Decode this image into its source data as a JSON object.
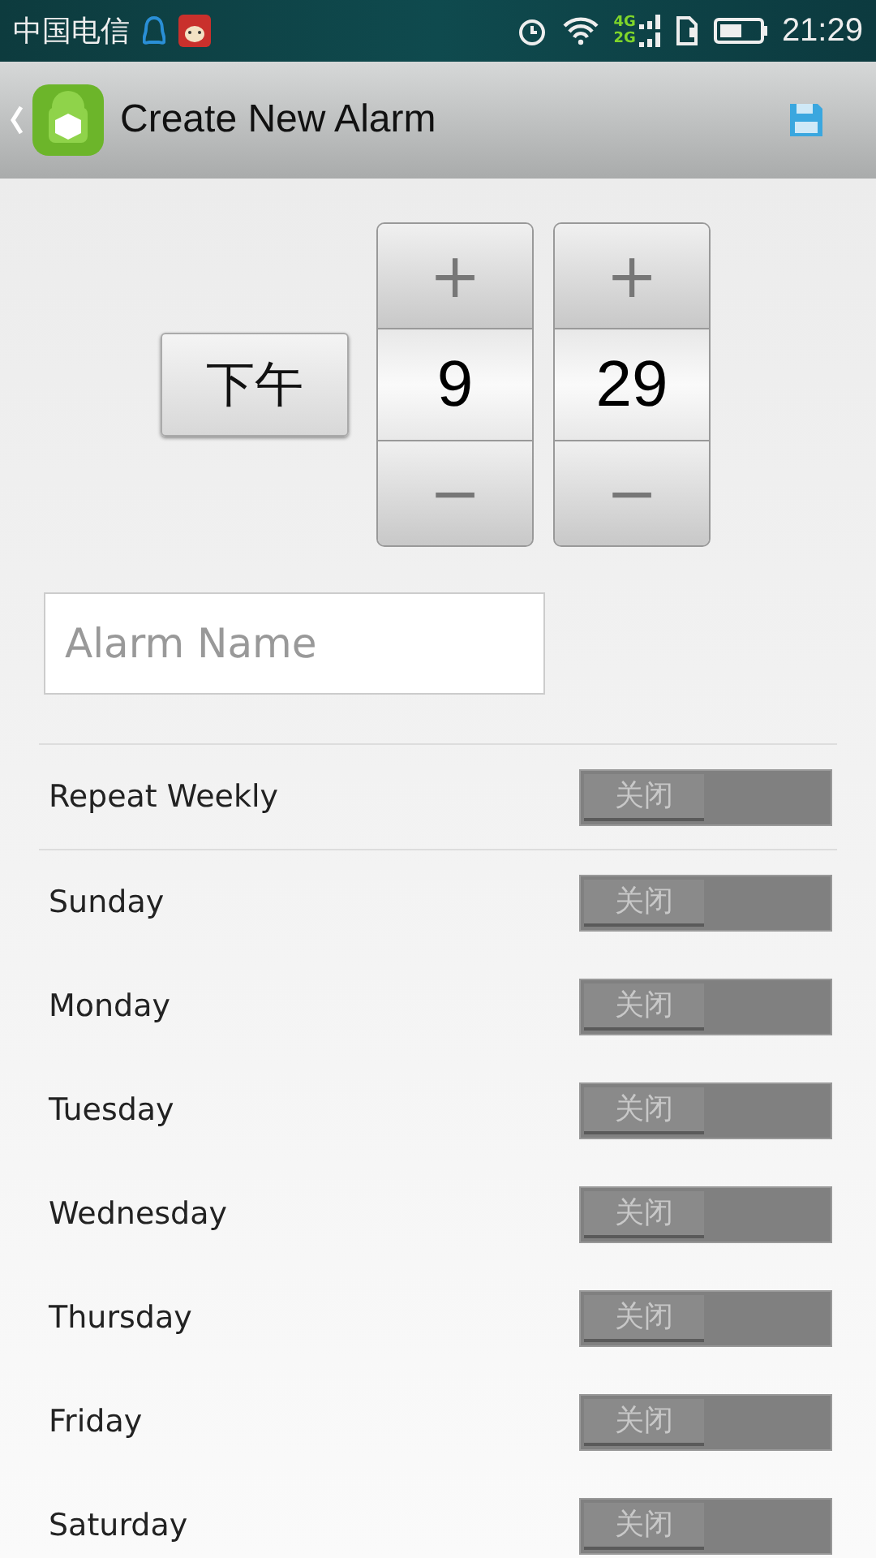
{
  "status_bar": {
    "carrier": "中国电信",
    "network_top": "4G",
    "network_bottom": "2G",
    "time": "21:29"
  },
  "title_bar": {
    "title": "Create New Alarm"
  },
  "time_picker": {
    "period": "下午",
    "spinners": [
      {
        "value": "9",
        "increment": "+",
        "decrement": "−"
      },
      {
        "value": "29",
        "increment": "+",
        "decrement": "−"
      }
    ]
  },
  "alarm_name": {
    "placeholder": "Alarm Name"
  },
  "rows": [
    {
      "label": "Repeat Weekly",
      "on": false,
      "switch_text": "关闭"
    },
    {
      "label": "Sunday",
      "on": false,
      "switch_text": "关闭"
    },
    {
      "label": "Monday",
      "on": false,
      "switch_text": "关闭"
    },
    {
      "label": "Tuesday",
      "on": false,
      "switch_text": "关闭"
    },
    {
      "label": "Wednesday",
      "on": false,
      "switch_text": "关闭"
    },
    {
      "label": "Thursday",
      "on": false,
      "switch_text": "关闭"
    },
    {
      "label": "Friday",
      "on": false,
      "switch_text": "关闭"
    },
    {
      "label": "Saturday",
      "on": false,
      "switch_text": "关闭"
    }
  ]
}
